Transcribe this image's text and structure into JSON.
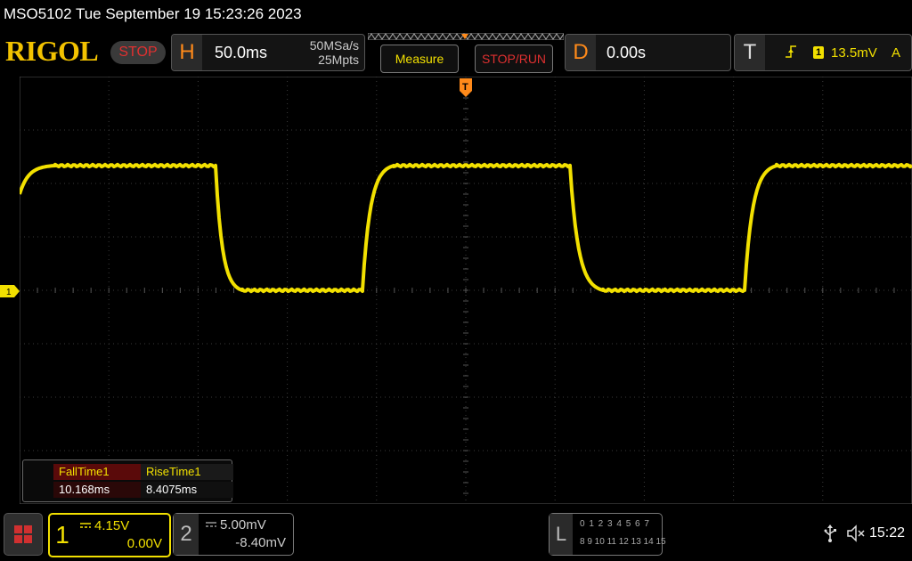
{
  "titlebar": {
    "text": "MSO5102  Tue September 19 15:23:26 2023"
  },
  "topbar": {
    "logo": "RIGOL",
    "run_status": "STOP",
    "horizontal": {
      "letter": "H",
      "timebase": "50.0ms",
      "sample_rate": "50MSa/s",
      "memory_depth": "25Mpts"
    },
    "measure_label": "Measure",
    "stoprun_label": "STOP/RUN",
    "delay": {
      "letter": "D",
      "value": "0.00s"
    },
    "trigger": {
      "letter": "T",
      "channel": "1",
      "level": "13.5mV",
      "mode": "A"
    }
  },
  "screen": {
    "trigger_marker": "T",
    "ch1_marker": "1",
    "colors": {
      "trace": "#f2e000",
      "grid": "#3a3a3a",
      "background": "#000000"
    }
  },
  "measurements": {
    "items": [
      {
        "label": "FallTime1",
        "value": "10.168ms"
      },
      {
        "label": "RiseTime1",
        "value": "8.4075ms"
      }
    ]
  },
  "bottombar": {
    "ch1": {
      "num": "1",
      "scale": "4.15V",
      "offset": "0.00V"
    },
    "ch2": {
      "num": "2",
      "scale": "5.00mV",
      "offset": "-8.40mV"
    },
    "la": {
      "letter": "L",
      "row1": "0 1 2 3  4 5 6 7",
      "row2": "8 9 10 11 12 13 14 15"
    },
    "clock": "15:22",
    "icons": [
      "menu-grid-icon",
      "usb-icon",
      "speaker-muted-icon"
    ]
  }
}
